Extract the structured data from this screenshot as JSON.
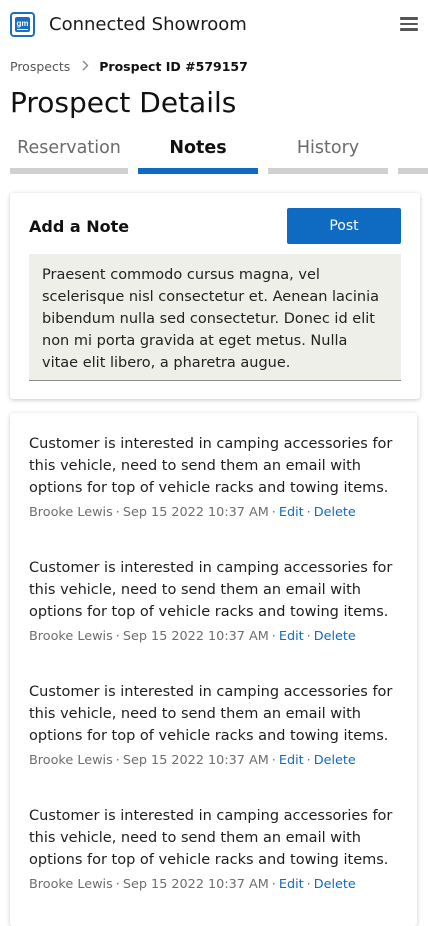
{
  "header": {
    "logo_text": "gm",
    "app_title": "Connected Showroom",
    "menu_icon": "hamburger-menu-icon"
  },
  "breadcrumb": {
    "parent": "Prospects",
    "separator_icon": "chevron-right-icon",
    "current": "Prospect ID #579157"
  },
  "page_title": "Prospect Details",
  "tabs": [
    {
      "label": "Reservation",
      "active": false
    },
    {
      "label": "Notes",
      "active": true
    },
    {
      "label": "History",
      "active": false
    }
  ],
  "add_note": {
    "title": "Add a Note",
    "post_label": "Post",
    "text_value": "Praesent commodo cursus magna, vel scelerisque nisl consectetur et. Aenean lacinia bibendum nulla sed consectetur. Donec id elit non mi porta gravida at eget metus. Nulla vitae elit libero, a pharetra augue."
  },
  "notes": [
    {
      "body": "Customer is interested in camping accessories for this vehicle, need to send them an email with options for top of vehicle racks and towing items.",
      "author": "Brooke Lewis",
      "date": "Sep 15 2022 10:37 AM",
      "edit_label": "Edit",
      "delete_label": "Delete"
    },
    {
      "body": "Customer is interested in camping accessories for this vehicle, need to send them an email with options for top of vehicle racks and towing items.",
      "author": "Brooke Lewis",
      "date": "Sep 15 2022 10:37 AM",
      "edit_label": "Edit",
      "delete_label": "Delete"
    },
    {
      "body": "Customer is interested in camping accessories for this vehicle, need to send them an email with options for top of vehicle racks and towing items.",
      "author": "Brooke Lewis",
      "date": "Sep 15 2022 10:37 AM",
      "edit_label": "Edit",
      "delete_label": "Delete"
    },
    {
      "body": "Customer is interested in camping accessories for this vehicle, need to send them an email with options for top of vehicle racks and towing items.",
      "author": "Brooke Lewis",
      "date": "Sep 15 2022 10:37 AM",
      "edit_label": "Edit",
      "delete_label": "Delete"
    }
  ],
  "colors": {
    "accent": "#0f6bc2",
    "tab_inactive_bar": "#d0d0d0",
    "textarea_bg": "#efefea"
  }
}
